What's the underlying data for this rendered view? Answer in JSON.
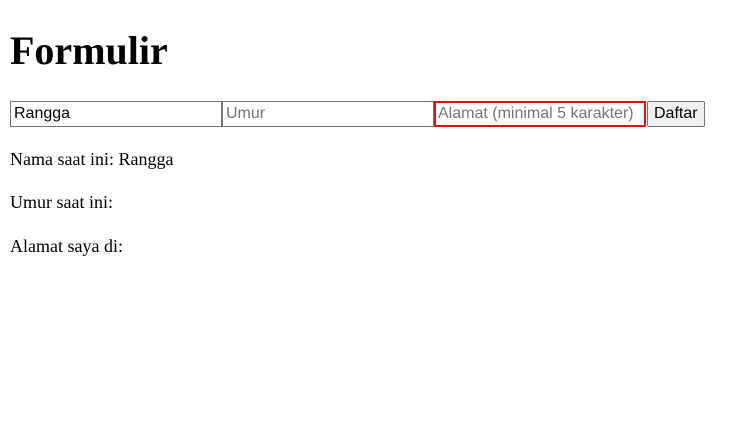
{
  "page": {
    "title": "Formulir"
  },
  "form": {
    "name_value": "Rangga",
    "name_placeholder": "",
    "age_value": "",
    "age_placeholder": "Umur",
    "address_value": "",
    "address_placeholder": "Alamat (minimal 5 karakter)",
    "address_invalid": true,
    "submit_label": "Daftar"
  },
  "output": {
    "name_label": "Nama saat ini: ",
    "name_value": "Rangga",
    "age_label": "Umur saat ini: ",
    "age_value": "",
    "address_label": "Alamat saya di: ",
    "address_value": ""
  },
  "colors": {
    "invalid_border": "#dd1111",
    "input_border": "#767676",
    "button_bg": "#efefef"
  }
}
